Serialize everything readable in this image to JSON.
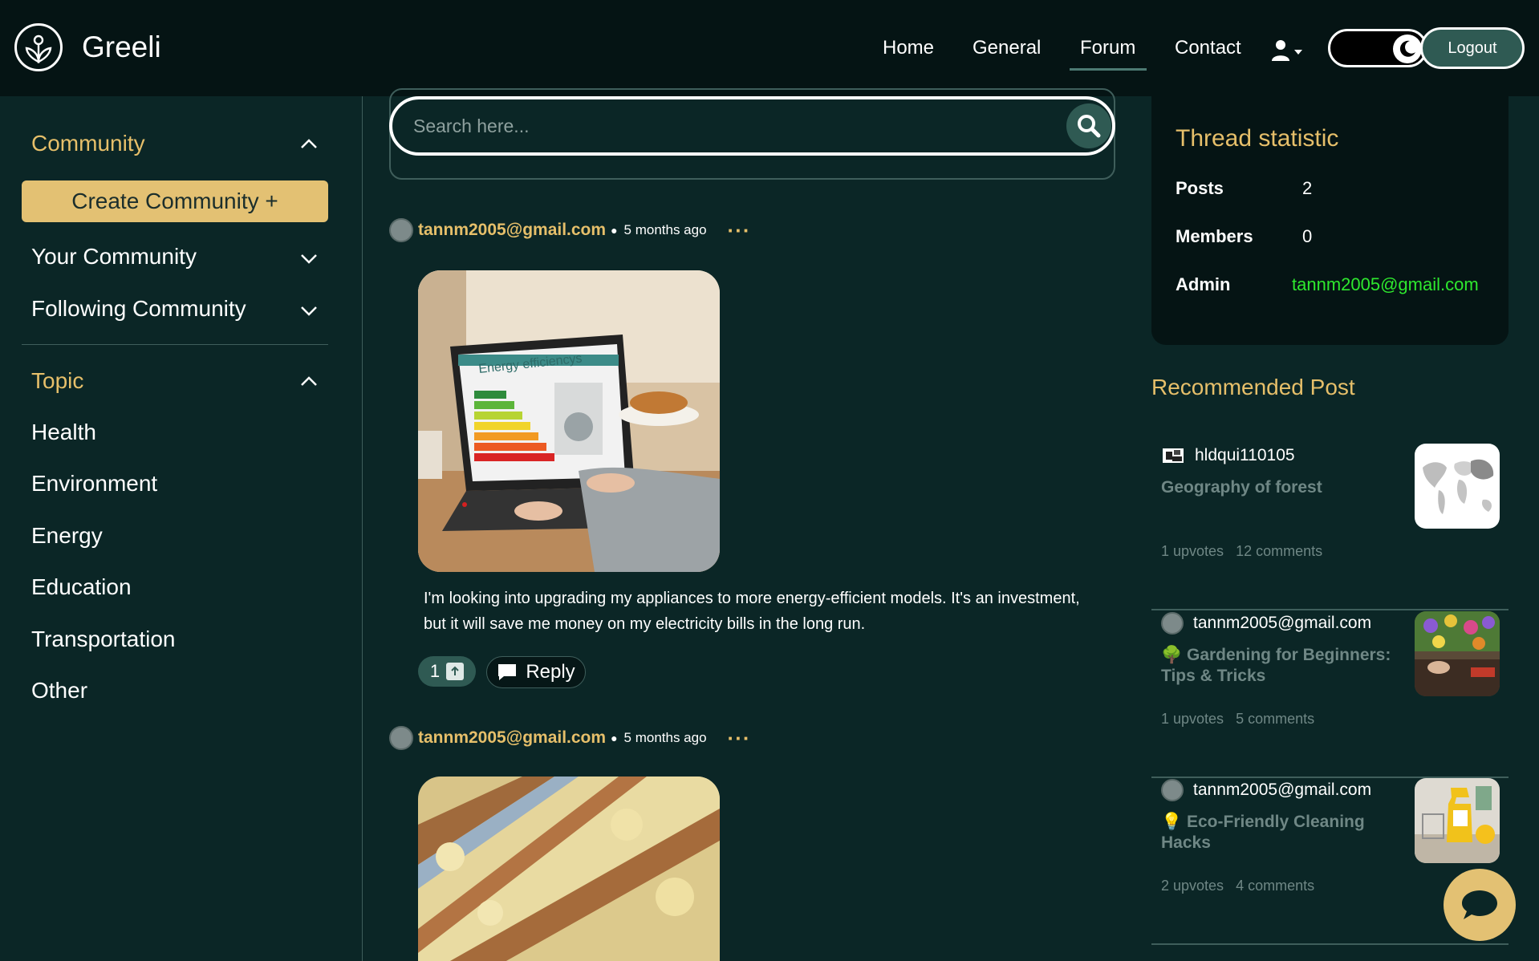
{
  "header": {
    "brand": "Greeli",
    "nav": [
      "Home",
      "General",
      "Forum",
      "Contact"
    ],
    "active_nav": "Forum",
    "logout_label": "Logout"
  },
  "sidebar": {
    "community_head": "Community",
    "create_label": "Create Community +",
    "your_community": "Your Community",
    "following_community": "Following Community",
    "topic_head": "Topic",
    "topics": [
      "Health",
      "Environment",
      "Energy",
      "Education",
      "Transportation",
      "Other"
    ]
  },
  "search": {
    "placeholder": "Search here..."
  },
  "posts": [
    {
      "author": "tannm2005@gmail.com",
      "time": "5 months ago",
      "more": "···",
      "text": "I'm looking into upgrading my appliances to more energy-efficient models. It's an investment, but it will save me money on my electricity bills in the long run.",
      "upvotes": "1",
      "reply_label": "Reply",
      "image_text": "Energy efficiencys"
    },
    {
      "author": "tannm2005@gmail.com",
      "time": "5 months ago",
      "more": "···"
    }
  ],
  "thread_stats": {
    "title": "Thread statistic",
    "posts_label": "Posts",
    "posts_value": "2",
    "members_label": "Members",
    "members_value": "0",
    "admin_label": "Admin",
    "admin_value": "tannm2005@gmail.com"
  },
  "recommended": {
    "title": "Recommended Post",
    "items": [
      {
        "user": "hldqui110105",
        "title": "Geography of forest",
        "upvotes": "1 upvotes",
        "comments": "12 comments"
      },
      {
        "user": "tannm2005@gmail.com",
        "title": "🌳 Gardening for Beginners: Tips & Tricks",
        "upvotes": "1 upvotes",
        "comments": "5 comments"
      },
      {
        "user": "tannm2005@gmail.com",
        "title": "💡 Eco-Friendly Cleaning Hacks",
        "upvotes": "2 upvotes",
        "comments": "4 comments"
      }
    ]
  },
  "colors": {
    "background": "#0b2626",
    "header": "#051414",
    "accent_gold": "#e6bf6a",
    "button_green": "#2f5a53",
    "admin_green": "#2ee82e"
  }
}
